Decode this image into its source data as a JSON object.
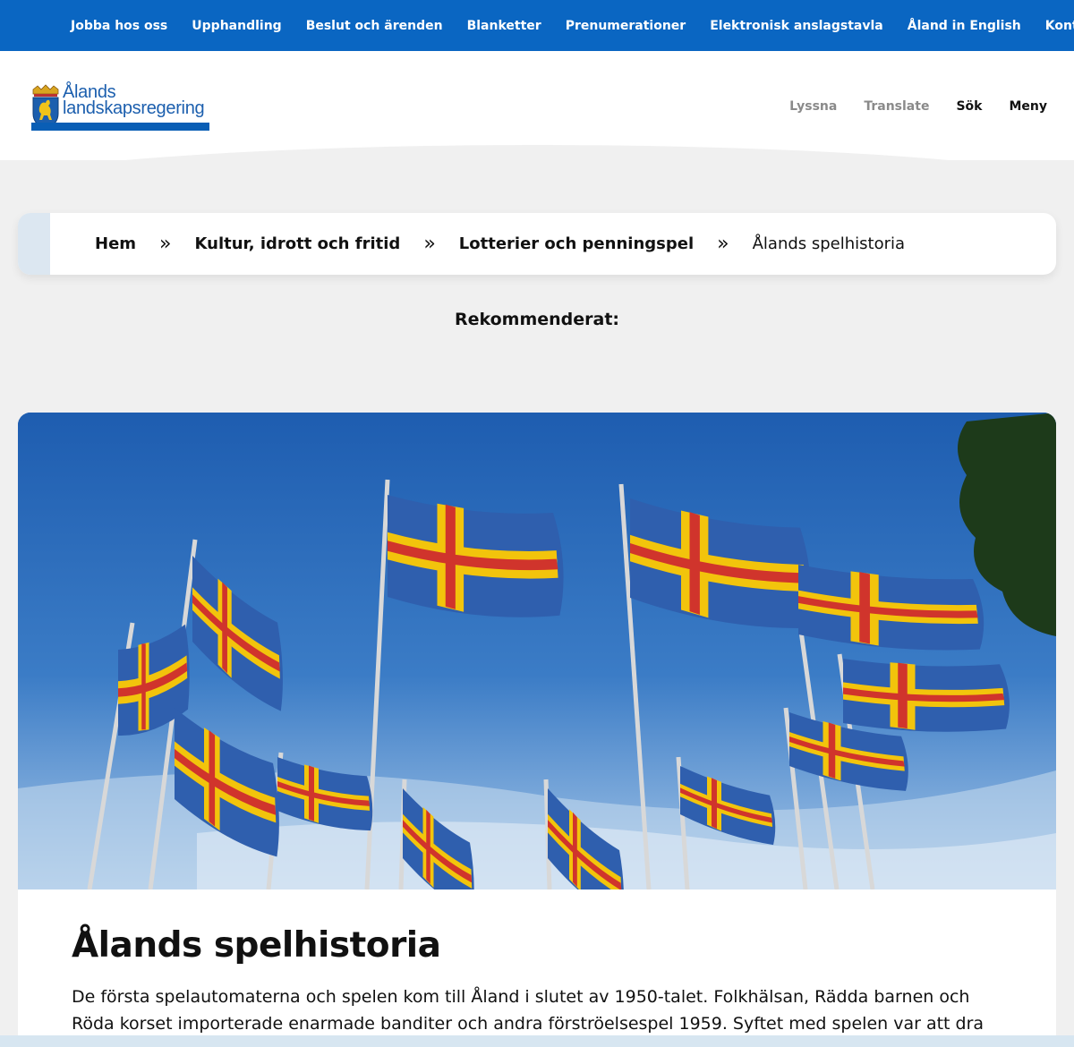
{
  "topnav": [
    "Jobba hos oss",
    "Upphandling",
    "Beslut och ärenden",
    "Blanketter",
    "Prenumerationer",
    "Elektronisk anslagstavla",
    "Åland in English",
    "Kontakt"
  ],
  "logo": {
    "line1": "Ålands",
    "line2": "landskapsregering",
    "icon": "aland-crest-icon"
  },
  "header_nav": {
    "listen": "Lyssna",
    "translate": "Translate",
    "search": "Sök",
    "menu": "Meny"
  },
  "breadcrumb": {
    "items": [
      "Hem",
      "Kultur, idrott och fritid",
      "Lotterier och penningspel",
      "Ålands spelhistoria"
    ],
    "separator": "»"
  },
  "recommended": "Rekommenderat:",
  "hero": {
    "image": "aland-flags-photo"
  },
  "article": {
    "title": "Ålands spelhistoria",
    "body": "De första spelautomaterna och spelen kom till Åland i slutet av 1950-talet. Folkhälsan, Rädda barnen och Röda korset importerade enarmade banditer och andra förströelsespel 1959. Syftet med spelen var att dra in pengar"
  },
  "colors": {
    "topbar": "#0a66c2",
    "brand_text": "#1c5fae",
    "flag_blue": "#2f5fae",
    "flag_yellow": "#f2c40c",
    "flag_red": "#d0342c"
  }
}
